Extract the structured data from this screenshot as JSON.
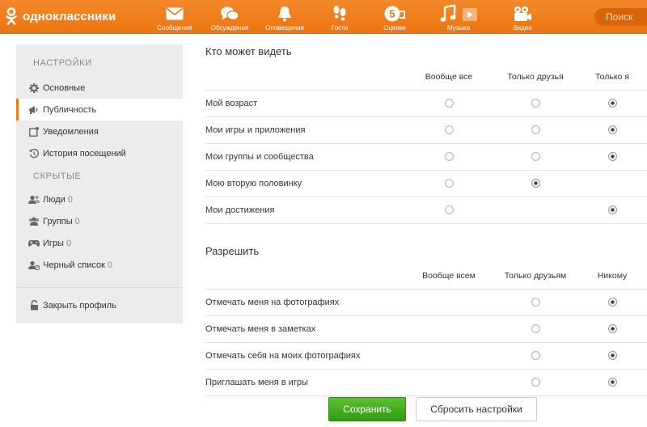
{
  "brand": {
    "name": "одноклассники"
  },
  "nav": [
    {
      "label": "Сообщения",
      "icon": "envelope-icon"
    },
    {
      "label": "Обсуждения",
      "icon": "chat-bubbles-icon"
    },
    {
      "label": "Оповещения",
      "icon": "bell-icon"
    },
    {
      "label": "Гости",
      "icon": "footprints-icon"
    },
    {
      "label": "Оценки",
      "icon": "rating-five-icon"
    },
    {
      "label": "Музыка",
      "icon": "music-note-icon"
    },
    {
      "label": "Видео",
      "icon": "video-camera-icon"
    }
  ],
  "search": {
    "placeholder": "Поиск"
  },
  "sidebar": {
    "settings_heading": "НАСТРОЙКИ",
    "settings_items": [
      {
        "label": "Основные",
        "icon": "gear-icon"
      },
      {
        "label": "Публичность",
        "icon": "megaphone-icon",
        "active": true
      },
      {
        "label": "Уведомления",
        "icon": "notification-icon"
      },
      {
        "label": "История посещений",
        "icon": "history-icon"
      }
    ],
    "hidden_heading": "СКРЫТЫЕ",
    "hidden_items": [
      {
        "label": "Люди",
        "count": "0",
        "icon": "people-icon"
      },
      {
        "label": "Группы",
        "count": "0",
        "icon": "groups-icon"
      },
      {
        "label": "Игры",
        "count": "0",
        "icon": "gamepad-icon"
      },
      {
        "label": "Черный список",
        "count": "0",
        "icon": "blacklist-icon"
      }
    ],
    "close_profile": {
      "label": "Закрыть профиль",
      "icon": "lock-icon"
    }
  },
  "visibility": {
    "title": "Кто может видеть",
    "columns": [
      "Вообще все",
      "Только друзья",
      "Только я"
    ],
    "rows": [
      {
        "label": "Мой возраст",
        "options": [
          true,
          true,
          true
        ],
        "selected": 2
      },
      {
        "label": "Мои игры и приложения",
        "options": [
          true,
          true,
          true
        ],
        "selected": 2
      },
      {
        "label": "Мои группы и сообщества",
        "options": [
          true,
          true,
          true
        ],
        "selected": 2
      },
      {
        "label": "Мою вторую половинку",
        "options": [
          true,
          true,
          false
        ],
        "selected": 1
      },
      {
        "label": "Мои достижения",
        "options": [
          true,
          false,
          true
        ],
        "selected": 2
      }
    ]
  },
  "permissions": {
    "title": "Разрешить",
    "columns": [
      "Вообще всем",
      "Только друзьям",
      "Никому"
    ],
    "rows": [
      {
        "label": "Отмечать меня на фотографиях",
        "options": [
          false,
          true,
          true
        ],
        "selected": 2
      },
      {
        "label": "Отмечать меня в заметках",
        "options": [
          false,
          true,
          true
        ],
        "selected": 2
      },
      {
        "label": "Отмечать себя на моих фотографиях",
        "options": [
          false,
          true,
          true
        ],
        "selected": 2
      },
      {
        "label": "Приглашать меня в игры",
        "options": [
          false,
          true,
          true
        ],
        "selected": 2
      }
    ]
  },
  "actions": {
    "save": "Сохранить",
    "reset": "Сбросить настройки"
  },
  "colors": {
    "brand": "#f07c18",
    "save": "#3aa41e"
  }
}
